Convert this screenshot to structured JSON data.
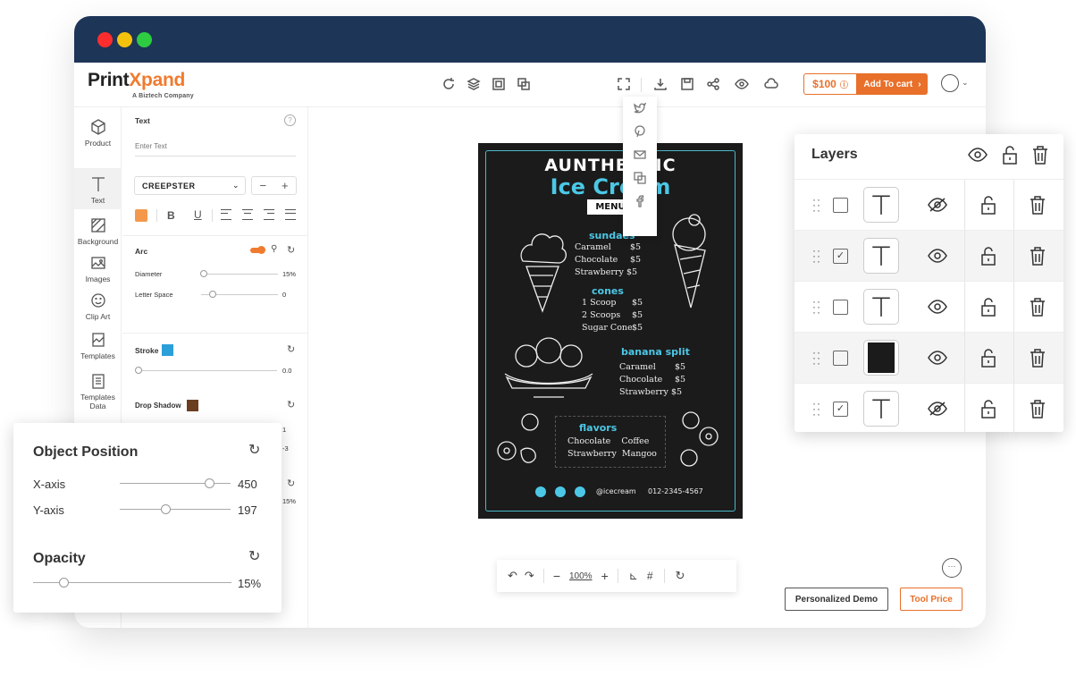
{
  "brand": {
    "name_part1": "Print",
    "name_part2": "Xpand",
    "tagline": "A Biztech Company"
  },
  "window_buttons": {
    "close": "#ff2d2d",
    "minimize": "#f4c20d",
    "maximize": "#2ecc40"
  },
  "toolbar": {
    "price": "$100",
    "add_to_cart": "Add To cart"
  },
  "left_nav": [
    {
      "label": "Product",
      "icon": "cube-icon"
    },
    {
      "label": "Text",
      "icon": "text-icon"
    },
    {
      "label": "Background",
      "icon": "background-icon"
    },
    {
      "label": "Images",
      "icon": "image-icon"
    },
    {
      "label": "Clip Art",
      "icon": "smiley-icon"
    },
    {
      "label": "Templates",
      "icon": "templates-icon"
    },
    {
      "label": "Templates Data",
      "icon": "templates-data-icon"
    }
  ],
  "props": {
    "text_label": "Text",
    "text_placeholder": "Enter Text",
    "font": "CREEPSTER",
    "text_color": "#f4994c",
    "arc_label": "Arc",
    "diameter_label": "Diameter",
    "diameter_value": "15%",
    "letter_space_label": "Letter Space",
    "letter_space_value": "0",
    "stroke_label": "Stroke",
    "stroke_color": "#2b9fd8",
    "stroke_value": "0.0",
    "shadow_label": "Drop Shadow",
    "shadow_color": "#6b3e20",
    "partial_value_1": "1",
    "partial_value_2": "-3",
    "partial_value_3": "15%"
  },
  "menu_board": {
    "title1": "AUNTHENTIC",
    "title2": "Ice Cream",
    "menu": "MENU",
    "sundaes_heading": "sundaes",
    "sundaes": [
      {
        "name": "Caramel",
        "price": "$5"
      },
      {
        "name": "Chocolate",
        "price": "$5"
      },
      {
        "name": "Strawberry",
        "price": "$5"
      }
    ],
    "cones_heading": "cones",
    "cones": [
      {
        "name": "1 Scoop",
        "price": "$5"
      },
      {
        "name": "2 Scoops",
        "price": "$5"
      },
      {
        "name": "Sugar Cone",
        "price": "$5"
      }
    ],
    "split_heading": "banana split",
    "split": [
      {
        "name": "Caramel",
        "price": "$5"
      },
      {
        "name": "Chocolate",
        "price": "$5"
      },
      {
        "name": "Strawberry",
        "price": "$5"
      }
    ],
    "flavors_heading": "flavors",
    "flavors_row1": "Chocolate    Coffee",
    "flavors_row2": "Strawberry  Mangoo",
    "handle": "@icecream",
    "phone": "012-2345-4567"
  },
  "canvas_toolbar": {
    "zoom": "100%"
  },
  "buttons": {
    "demo": "Personalized Demo",
    "price": "Tool Price"
  },
  "layers": {
    "title": "Layers",
    "rows": [
      {
        "checked": false,
        "thumb": "text",
        "visible": false
      },
      {
        "checked": true,
        "thumb": "text",
        "visible": true
      },
      {
        "checked": false,
        "thumb": "text",
        "visible": true
      },
      {
        "checked": false,
        "thumb": "image",
        "visible": true
      },
      {
        "checked": true,
        "thumb": "text",
        "visible": false
      }
    ]
  },
  "object_position": {
    "title": "Object Position",
    "x_label": "X-axis",
    "x_value": "450",
    "y_label": "Y-axis",
    "y_value": "197",
    "opacity_label": "Opacity",
    "opacity_value": "15%"
  }
}
